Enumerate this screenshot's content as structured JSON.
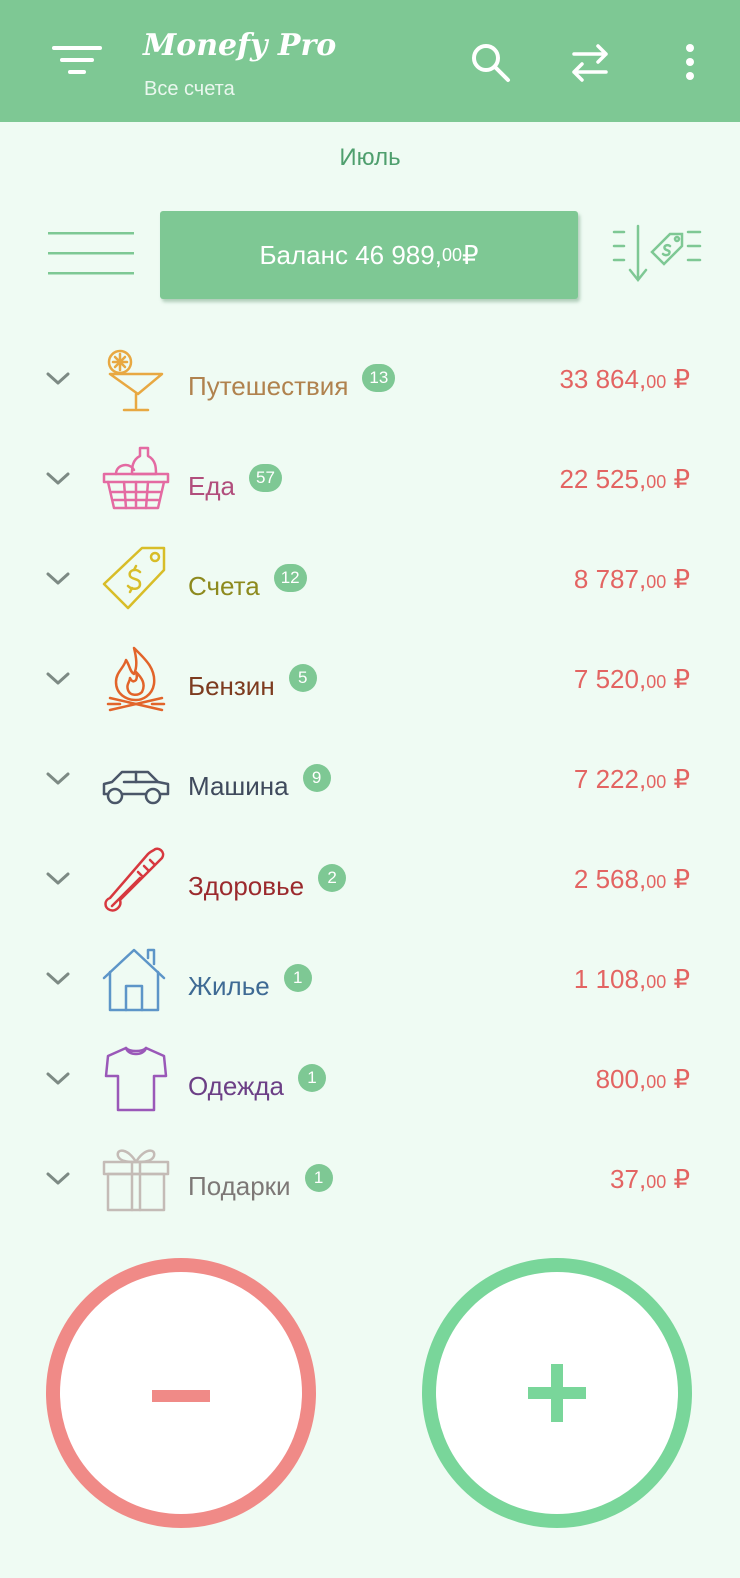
{
  "app": {
    "title": "Monefy Pro",
    "subtitle": "Все счета"
  },
  "period": "Июль",
  "balance": {
    "label": "Баланс 46 989,",
    "frac": "00",
    "currency": " ₽"
  },
  "categories": [
    {
      "name": "Путешествия",
      "count": "13",
      "amount": "33 864,",
      "frac": "00",
      "currency": " ₽",
      "icon": "cocktail-icon",
      "color": "#b0824e"
    },
    {
      "name": "Еда",
      "count": "57",
      "amount": "22 525,",
      "frac": "00",
      "currency": " ₽",
      "icon": "food-basket-icon",
      "color": "#b14e7c"
    },
    {
      "name": "Счета",
      "count": "12",
      "amount": "8 787,",
      "frac": "00",
      "currency": " ₽",
      "icon": "price-tag-icon",
      "color": "#8d8a1e"
    },
    {
      "name": "Бензин",
      "count": "5",
      "amount": "7 520,",
      "frac": "00",
      "currency": " ₽",
      "icon": "flame-icon",
      "color": "#7d3b1f"
    },
    {
      "name": "Машина",
      "count": "9",
      "amount": "7 222,",
      "frac": "00",
      "currency": " ₽",
      "icon": "car-icon",
      "color": "#3f4a5c"
    },
    {
      "name": "Здоровье",
      "count": "2",
      "amount": "2 568,",
      "frac": "00",
      "currency": " ₽",
      "icon": "thermometer-icon",
      "color": "#9b2a2d"
    },
    {
      "name": "Жилье",
      "count": "1",
      "amount": "1 108,",
      "frac": "00",
      "currency": " ₽",
      "icon": "house-icon",
      "color": "#3e6a94"
    },
    {
      "name": "Одежда",
      "count": "1",
      "amount": "800,",
      "frac": "00",
      "currency": " ₽",
      "icon": "tshirt-icon",
      "color": "#6c3f86"
    },
    {
      "name": "Подарки",
      "count": "1",
      "amount": "37,",
      "frac": "00",
      "currency": " ₽",
      "icon": "gift-icon",
      "color": "#7d7876"
    }
  ],
  "colors": {
    "primary": "#7ec894",
    "background": "#effbf3",
    "expense": "#e36462",
    "fab_expense": "#f08a87",
    "fab_income": "#79d69a"
  }
}
